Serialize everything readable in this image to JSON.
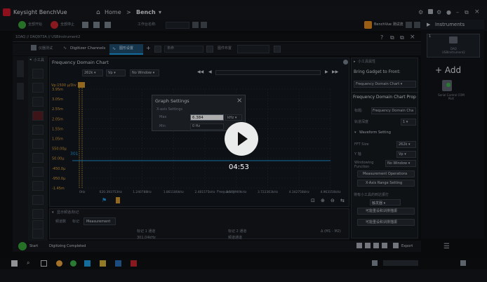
{
  "app": {
    "title": "Keysight BenchVue",
    "home_label": "Home",
    "breadcrumb_sep": ">",
    "bench_label": "Bench",
    "bench_caret": "▾",
    "bench_test_flow": "BenchVue 测试流",
    "instruments_tab": "Instruments"
  },
  "toolbar": {
    "start_all": "全部开始",
    "stop_all": "全部停止",
    "page_label": "工作台名称:"
  },
  "path": {
    "text": "1DAQ // DAQ973A // USBInstrument2"
  },
  "tabs": [
    {
      "label": "仪器测试"
    },
    {
      "label": "Digitizer Channels"
    },
    {
      "label": "图形设置"
    }
  ],
  "tab_extra": {
    "unnamed": "未命",
    "trigger": "图件布置",
    "plus": "+"
  },
  "left_panel": {
    "label": "小工具"
  },
  "chart": {
    "title": "Frequency Domain Chart",
    "fft_size": "262k",
    "y_unit": "Vp",
    "window": "No Window",
    "y_axis_title": "Vp:1500 μ/Div",
    "y_ticks": [
      "3.95m",
      "3.05m",
      "2.55m",
      "2.05m",
      "1.55m",
      "1.05m",
      "550.00μ",
      "50.00μ",
      "-450.0μ",
      "-950.0μ",
      "-1.45m"
    ],
    "x_ticks": [
      "0Hz",
      "620.393753Hz",
      "1.240788Hz",
      "1.861180kHz",
      "2.481575kHz",
      "3.101969kHz",
      "3.722363kHz",
      "4.342758kHz",
      "4.963150kHz"
    ],
    "x_axis_title": "Frequency",
    "marker_value": "301"
  },
  "graph_settings": {
    "title": "Graph Settings",
    "section": "X-axis Settings",
    "max_label": "Max",
    "max_value": "6.384",
    "max_unit": "kHz",
    "min_label": "Min",
    "min_value": "0 Hz"
  },
  "video": {
    "time": "04:53"
  },
  "bottom_panel": {
    "header": "显示频道/标记",
    "tabs": [
      "频道数",
      "标记",
      "Measurement"
    ],
    "col1": "标记 1 通道",
    "col2": "标记 2 通道",
    "col3": "Δ (M1 - M2)",
    "val1": "301.04kHz",
    "val2": "频道通道"
  },
  "right_panel": {
    "header": "小工具属性",
    "bring_title": "Bring Gadget to Front:",
    "bring_value": "Frequency Domain Chart",
    "props_title": "Frequency Domain Chart Prop",
    "title_label": "标题:",
    "title_value": "Frequency Domain Cha",
    "channel_label": "轨道深度",
    "channel_value": "1",
    "waveform_section": "Waveform Setting",
    "fft_label": "FFT Size",
    "fft_value": "262k",
    "yaxis_label": "Y 轴",
    "yaxis_value": "Vp",
    "windowing_label": "Windowing Function",
    "windowing_value": "No Window",
    "measurement_btn": "Measurement Operations",
    "xaxis_btn": "X-Axis Range Setting",
    "tool_label": "将有小工具的到达振打",
    "tool_value": "触发器",
    "btn1": "可能重设和训排描振",
    "btn2": "可能重设和训排描振"
  },
  "instrument_card": {
    "name": "DAQ\nUSBInstrument2",
    "num": "1",
    "label": "Serial Control COM Port"
  },
  "add_label": "+ Add",
  "status": {
    "start": "Start",
    "text": "Digitizing Completed",
    "export": "Export"
  },
  "colors": {
    "accent": "#1ea0e6",
    "marker": "#f2a93b",
    "play": "#ffffff"
  }
}
